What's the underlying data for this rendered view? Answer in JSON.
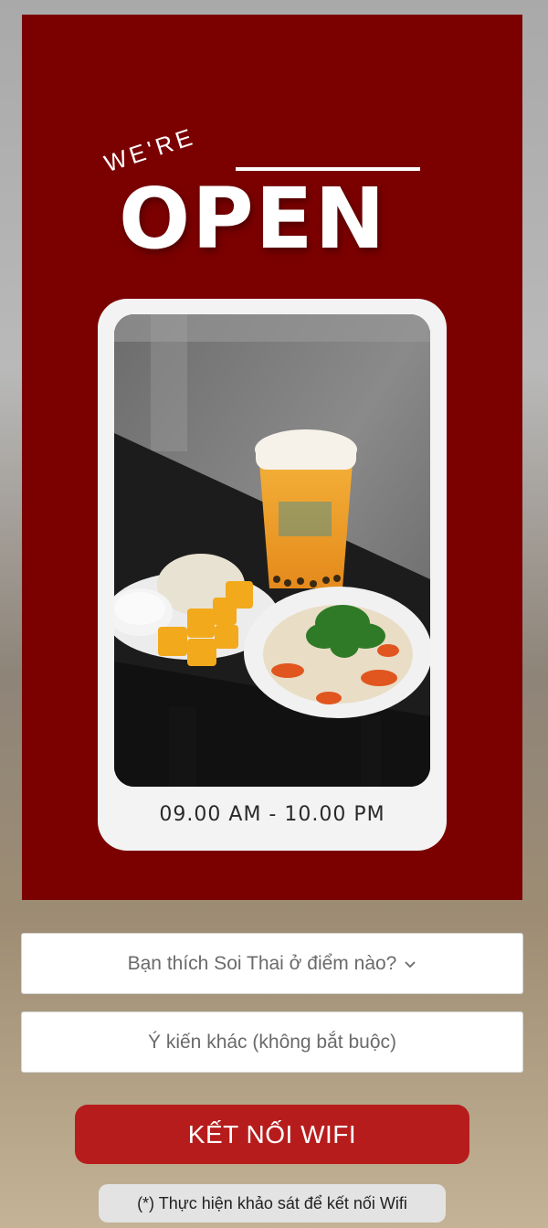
{
  "poster": {
    "were_text": "WE'RE",
    "open_text": "OPEN",
    "hours": "09.00 AM - 10.00 PM",
    "photo": "food-photo"
  },
  "form": {
    "location_select": {
      "value": "Bạn thích Soi Thai ở điểm nào?",
      "icon": "chevron-down-icon"
    },
    "feedback_input": {
      "placeholder": "Ý kiến khác (không bắt buộc)"
    },
    "submit_label": "KẾT NỐI WIFI",
    "note": "(*) Thực hiện khảo sát để kết nối Wifi"
  },
  "colors": {
    "poster_bg": "#7b0000",
    "button_bg": "#b71c1c"
  }
}
